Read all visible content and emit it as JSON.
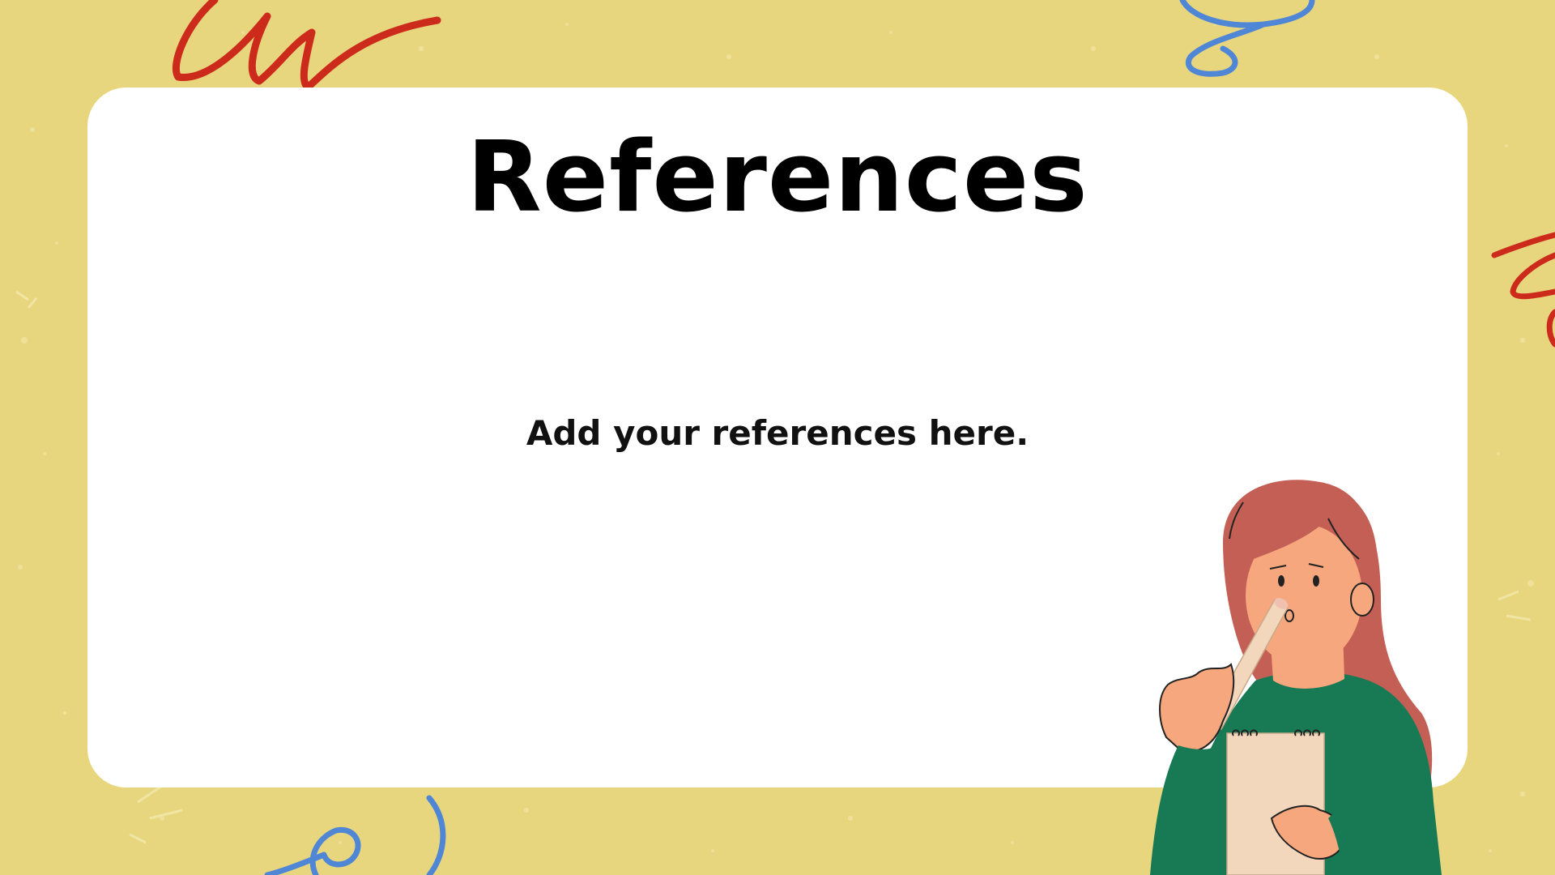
{
  "slide": {
    "title": "References",
    "body": "Add your references here."
  },
  "colors": {
    "background": "#e8d67e",
    "card": "#ffffff",
    "scribble_red": "#cc2a1b",
    "scribble_blue": "#4f86d6",
    "sweater": "#177a55",
    "hair": "#c45f55",
    "skin": "#f7a77d",
    "notepad": "#f2d7bd"
  },
  "decorations": {
    "scribbles": [
      "red-scribble-top-left",
      "blue-scribble-top-right",
      "red-scribble-right",
      "blue-scribble-bottom-left"
    ],
    "illustration": "woman-thinking-with-pen-and-notepad"
  }
}
